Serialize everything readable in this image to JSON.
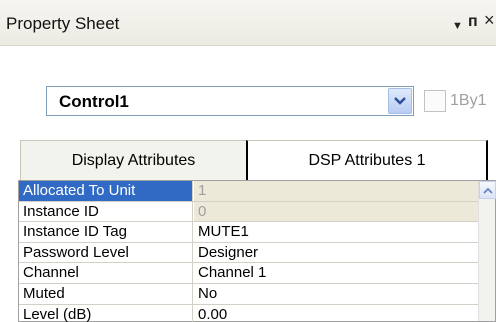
{
  "window": {
    "title": "Property Sheet",
    "menu_glyph": "▼",
    "pin_glyph": "ᴨ",
    "close_glyph": "×"
  },
  "selector": {
    "value": "Control1",
    "checkbox_label": "1By1"
  },
  "tabs": [
    {
      "label": "Display Attributes",
      "active": false
    },
    {
      "label": "DSP Attributes 1",
      "active": true
    }
  ],
  "properties": [
    {
      "name": "Allocated To Unit",
      "value": "1",
      "selected": true,
      "readonly": true
    },
    {
      "name": "Instance ID",
      "value": "0",
      "selected": false,
      "readonly": true
    },
    {
      "name": "Instance ID Tag",
      "value": "MUTE1",
      "selected": false,
      "readonly": false
    },
    {
      "name": "Password Level",
      "value": "Designer",
      "selected": false,
      "readonly": false
    },
    {
      "name": "Channel",
      "value": "Channel 1",
      "selected": false,
      "readonly": false
    },
    {
      "name": "Muted",
      "value": "No",
      "selected": false,
      "readonly": false
    },
    {
      "name": "Level (dB)",
      "value": "0.00",
      "selected": false,
      "readonly": false
    }
  ],
  "colors": {
    "selection": "#316ac5",
    "readonly_bg": "#ece9d8",
    "grid_line": "#d4d0c8"
  },
  "icons": {
    "dropdown": "chevron-down-icon",
    "scroll_up": "chevron-up-icon"
  }
}
